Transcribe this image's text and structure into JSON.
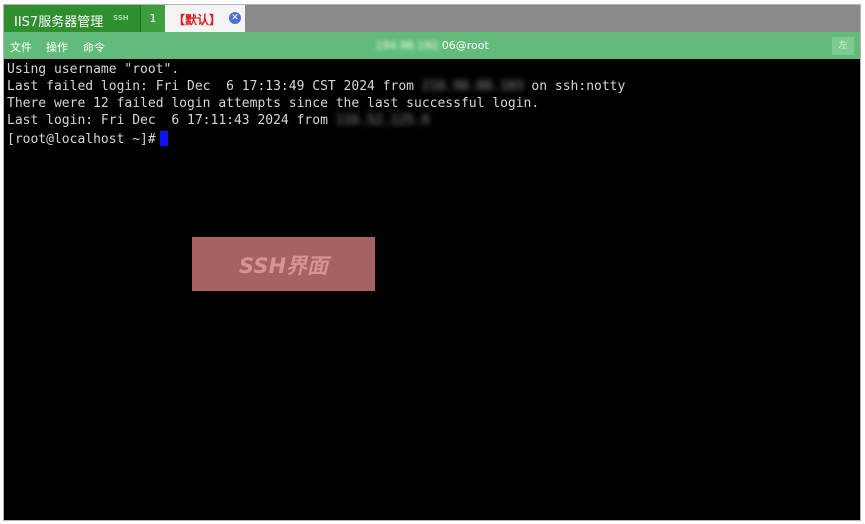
{
  "tabs": {
    "app_title": "IIS7服务器管理",
    "ssh_badge": "SSH",
    "tab_number": "1",
    "session_label": "【默认】"
  },
  "menubar": {
    "items": [
      "文件",
      "操作",
      "命令"
    ],
    "host_blurred": "194.98.192.",
    "host_visible": "06@root",
    "right_button": "左"
  },
  "terminal": {
    "lines": [
      "Using username \"root\".",
      "There were 12 failed login attempts since the last successful login."
    ],
    "last_failed_prefix": "Last failed login: Fri Dec  6 17:13:49 CST 2024 from ",
    "last_failed_ip_blurred": "218.90.88.103",
    "last_failed_suffix": " on ssh:notty",
    "last_login_prefix": "Last login: Fri Dec  6 17:11:43 2024 from ",
    "last_login_ip_blurred": "116.52.125.6",
    "prompt": "[root@localhost ~]#"
  },
  "overlay_label": "SSH界面",
  "colors": {
    "app_tab": "#2f8f2f",
    "menubar": "#62bb7a",
    "terminal_bg": "#000000",
    "cursor": "#1010ff",
    "session_label": "#e02020"
  }
}
